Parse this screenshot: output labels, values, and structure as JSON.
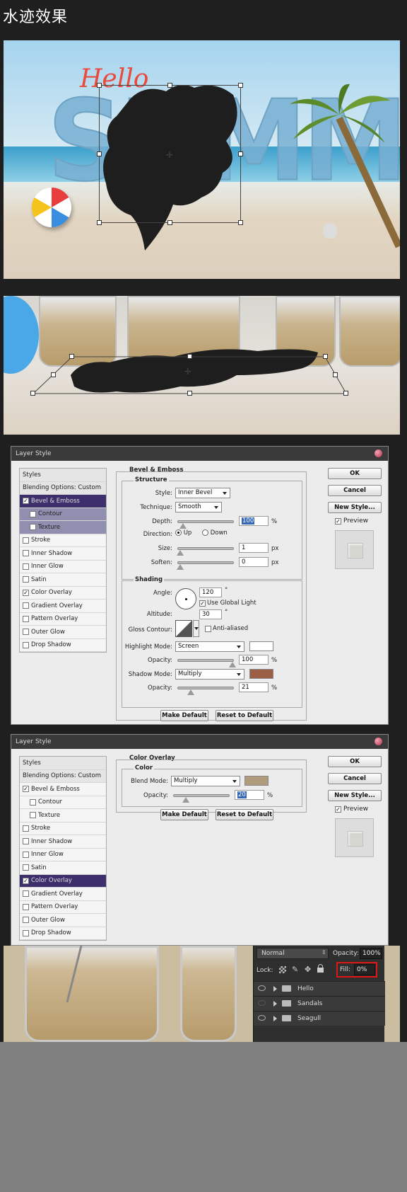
{
  "page": {
    "title": "水迹效果"
  },
  "scene1": {
    "hello": "Hello",
    "summer": "SUMMER"
  },
  "dialog1": {
    "title": "Layer Style",
    "styles_list": [
      {
        "label": "Styles",
        "type": "header",
        "checked": null
      },
      {
        "label": "Blending Options: Custom",
        "type": "header",
        "checked": null
      },
      {
        "label": "Bevel & Emboss",
        "type": "item",
        "checked": true,
        "state": "selected"
      },
      {
        "label": "Contour",
        "type": "sub",
        "checked": false,
        "state": "hl"
      },
      {
        "label": "Texture",
        "type": "sub",
        "checked": false,
        "state": "hl"
      },
      {
        "label": "Stroke",
        "type": "item",
        "checked": false
      },
      {
        "label": "Inner Shadow",
        "type": "item",
        "checked": false
      },
      {
        "label": "Inner Glow",
        "type": "item",
        "checked": false
      },
      {
        "label": "Satin",
        "type": "item",
        "checked": false
      },
      {
        "label": "Color Overlay",
        "type": "item",
        "checked": true
      },
      {
        "label": "Gradient Overlay",
        "type": "item",
        "checked": false
      },
      {
        "label": "Pattern Overlay",
        "type": "item",
        "checked": false
      },
      {
        "label": "Outer Glow",
        "type": "item",
        "checked": false
      },
      {
        "label": "Drop Shadow",
        "type": "item",
        "checked": false
      }
    ],
    "section_title": "Bevel & Emboss",
    "structure": {
      "title": "Structure",
      "style_label": "Style:",
      "style_value": "Inner Bevel",
      "technique_label": "Technique:",
      "technique_value": "Smooth",
      "depth_label": "Depth:",
      "depth_value": "100",
      "depth_unit": "%",
      "direction_label": "Direction:",
      "dir_up": "Up",
      "dir_down": "Down",
      "size_label": "Size:",
      "size_value": "1",
      "size_unit": "px",
      "soften_label": "Soften:",
      "soften_value": "0",
      "soften_unit": "px"
    },
    "shading": {
      "title": "Shading",
      "angle_label": "Angle:",
      "angle_value": "120",
      "degree": "°",
      "global_light": "Use Global Light",
      "altitude_label": "Altitude:",
      "altitude_value": "30",
      "gloss_label": "Gloss Contour:",
      "anti_aliased": "Anti-aliased",
      "highlight_label": "Highlight Mode:",
      "highlight_value": "Screen",
      "highlight_color": "#ffffff",
      "opacity_label": "Opacity:",
      "highlight_opacity": "100",
      "pct": "%",
      "shadow_label": "Shadow Mode:",
      "shadow_value": "Multiply",
      "shadow_color": "#9a5f45",
      "shadow_opacity": "21"
    },
    "make_default": "Make Default",
    "reset_default": "Reset to Default",
    "ok": "OK",
    "cancel": "Cancel",
    "new_style": "New Style...",
    "preview": "Preview"
  },
  "dialog2": {
    "title": "Layer Style",
    "styles_list": [
      {
        "label": "Styles",
        "type": "header",
        "checked": null
      },
      {
        "label": "Blending Options: Custom",
        "type": "header",
        "checked": null
      },
      {
        "label": "Bevel & Emboss",
        "type": "item",
        "checked": true
      },
      {
        "label": "Contour",
        "type": "sub",
        "checked": false
      },
      {
        "label": "Texture",
        "type": "sub",
        "checked": false
      },
      {
        "label": "Stroke",
        "type": "item",
        "checked": false
      },
      {
        "label": "Inner Shadow",
        "type": "item",
        "checked": false
      },
      {
        "label": "Inner Glow",
        "type": "item",
        "checked": false
      },
      {
        "label": "Satin",
        "type": "item",
        "checked": false
      },
      {
        "label": "Color Overlay",
        "type": "item",
        "checked": true,
        "state": "selected"
      },
      {
        "label": "Gradient Overlay",
        "type": "item",
        "checked": false
      },
      {
        "label": "Pattern Overlay",
        "type": "item",
        "checked": false
      },
      {
        "label": "Outer Glow",
        "type": "item",
        "checked": false
      },
      {
        "label": "Drop Shadow",
        "type": "item",
        "checked": false
      }
    ],
    "section_title": "Color Overlay",
    "color_title": "Color",
    "blend_label": "Blend Mode:",
    "blend_value": "Multiply",
    "overlay_color": "#b09c7c",
    "opacity_label": "Opacity:",
    "opacity_value": "20",
    "pct": "%",
    "make_default": "Make Default",
    "reset_default": "Reset to Default",
    "ok": "OK",
    "cancel": "Cancel",
    "new_style": "New Style...",
    "preview": "Preview"
  },
  "layers_panel": {
    "blend_mode": "Normal",
    "opacity_label": "Opacity:",
    "opacity_value": "100%",
    "lock_label": "Lock:",
    "fill_label": "Fill:",
    "fill_value": "0%",
    "layers": [
      {
        "name": "Hello",
        "visible": true
      },
      {
        "name": "Sandals",
        "visible": false
      },
      {
        "name": "Seagull",
        "visible": true
      }
    ]
  }
}
